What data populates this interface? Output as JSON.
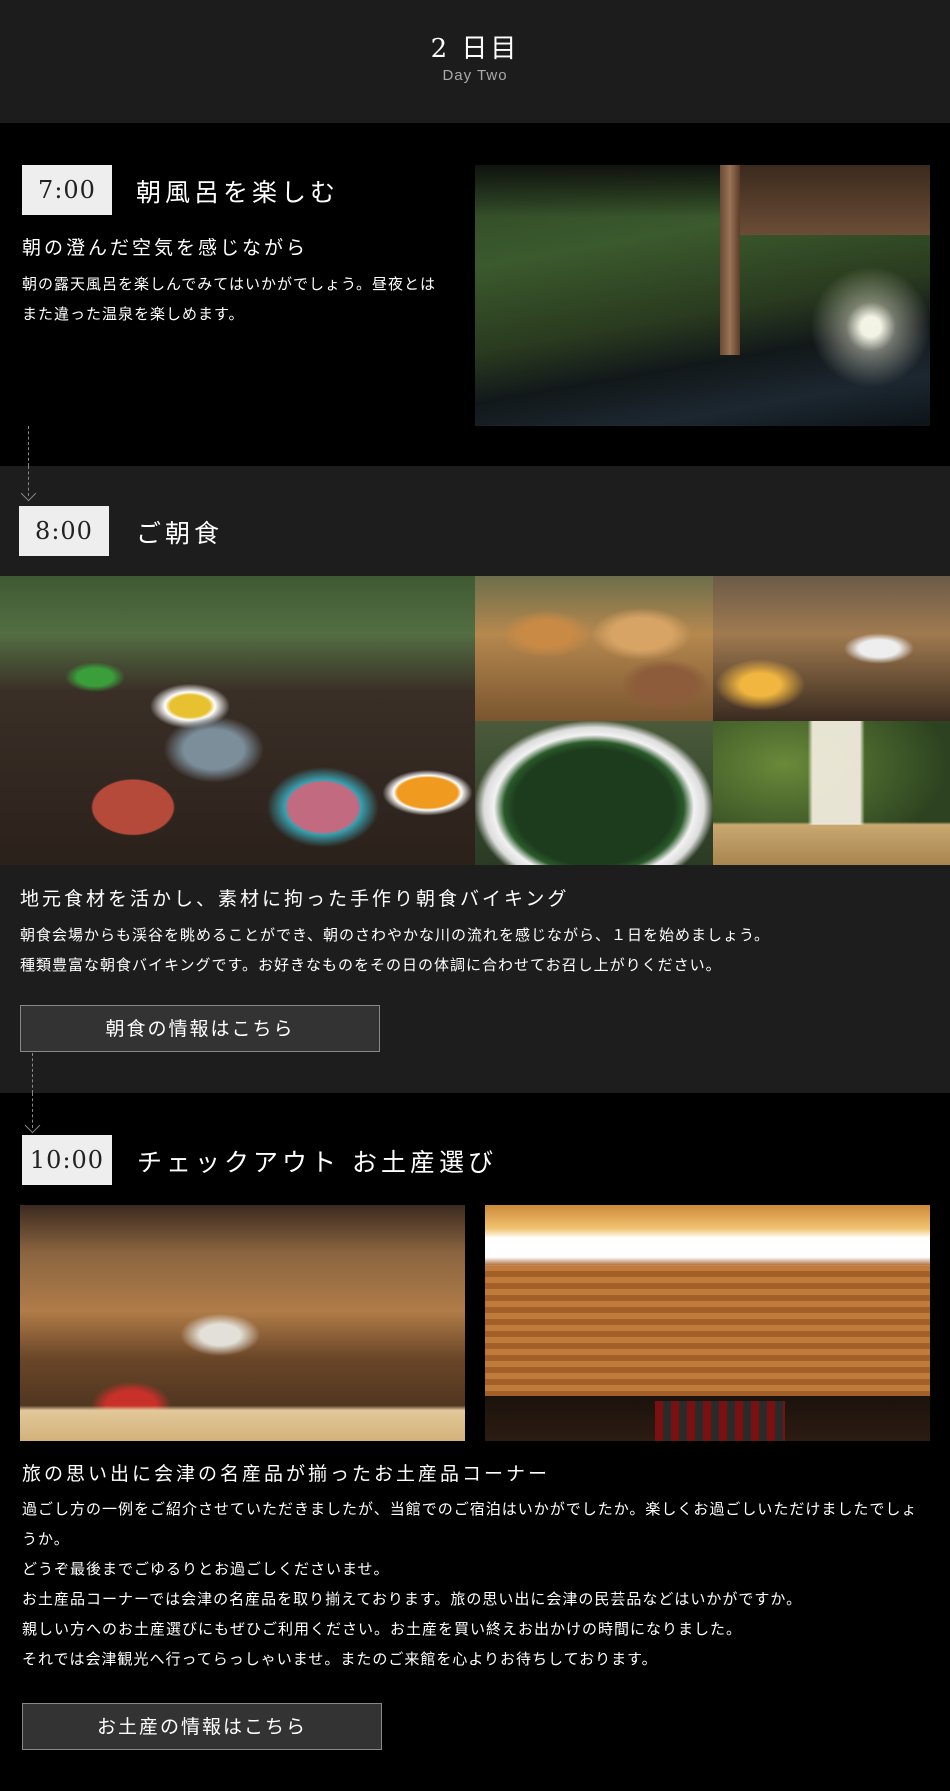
{
  "header": {
    "title": "2 日目",
    "subtitle": "Day Two"
  },
  "sections": [
    {
      "time": "7:00",
      "title": "朝風呂を楽しむ",
      "subtitle": "朝の澄んだ空気を感じながら",
      "body": [
        "朝の露天風呂を楽しんでみてはいかがでしょう。昼夜とは",
        "また違った温泉を楽しめます。"
      ]
    },
    {
      "time": "8:00",
      "title": "ご朝食",
      "subtitle": "地元食材を活かし、素材に拘った手作り朝食バイキング",
      "body": [
        "朝食会場からも渓谷を眺めることができ、朝のさわやかな川の流れを感じながら、１日を始めましょう。",
        "種類豊富な朝食バイキングです。お好きなものをその日の体調に合わせてお召し上がりください。"
      ],
      "button": "朝食の情報はこちら"
    },
    {
      "time": "10:00",
      "title": "チェックアウト お土産選び",
      "subtitle": "旅の思い出に会津の名産品が揃ったお土産品コーナー",
      "body": [
        "過ごし方の一例をご紹介させていただきましたが、当館でのご宿泊はいかがでしたか。楽しくお過ごしいただけましたでしょ",
        "うか。",
        "どうぞ最後までごゆるりとお過ごしくださいませ。",
        "お土産品コーナーでは会津の名産品を取り揃えております。旅の思い出に会津の民芸品などはいかがですか。",
        "親しい方へのお土産選びにもぜひご利用ください。お土産を買い終えお出かけの時間になりました。",
        "それでは会津観光へ行ってらっしゃいませ。またのご来館を心よりお待ちしております。"
      ],
      "button": "お土産の情報はこちら"
    }
  ]
}
